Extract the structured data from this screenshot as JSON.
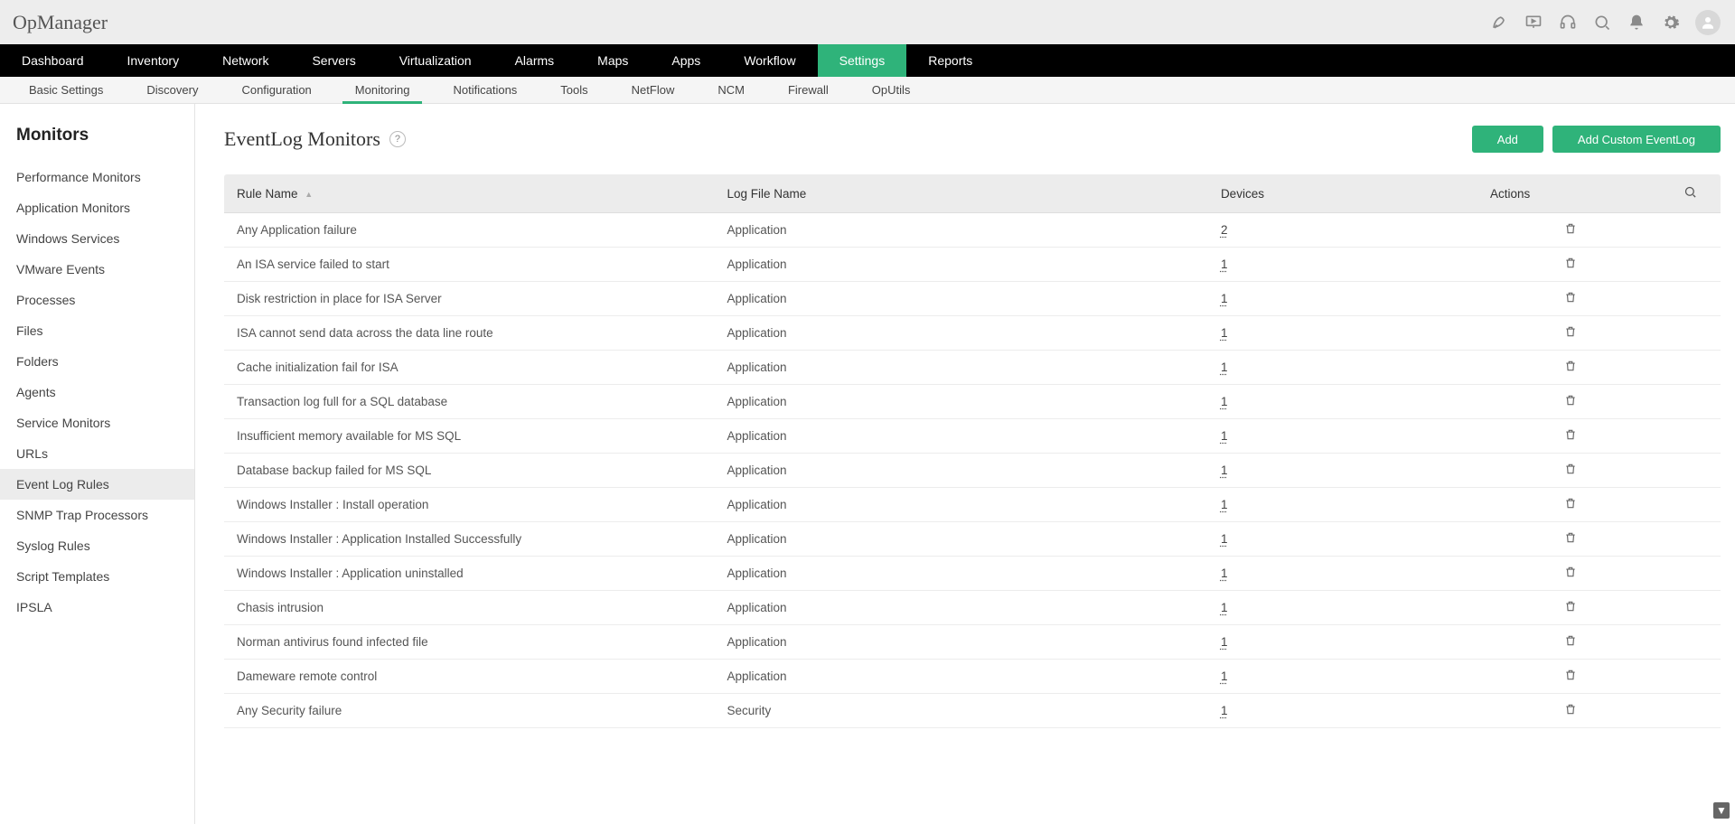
{
  "brand": "OpManager",
  "mainNav": [
    {
      "label": "Dashboard",
      "active": false
    },
    {
      "label": "Inventory",
      "active": false
    },
    {
      "label": "Network",
      "active": false
    },
    {
      "label": "Servers",
      "active": false
    },
    {
      "label": "Virtualization",
      "active": false
    },
    {
      "label": "Alarms",
      "active": false
    },
    {
      "label": "Maps",
      "active": false
    },
    {
      "label": "Apps",
      "active": false
    },
    {
      "label": "Workflow",
      "active": false
    },
    {
      "label": "Settings",
      "active": true
    },
    {
      "label": "Reports",
      "active": false
    }
  ],
  "subNav": [
    {
      "label": "Basic Settings",
      "active": false
    },
    {
      "label": "Discovery",
      "active": false
    },
    {
      "label": "Configuration",
      "active": false
    },
    {
      "label": "Monitoring",
      "active": true
    },
    {
      "label": "Notifications",
      "active": false
    },
    {
      "label": "Tools",
      "active": false
    },
    {
      "label": "NetFlow",
      "active": false
    },
    {
      "label": "NCM",
      "active": false
    },
    {
      "label": "Firewall",
      "active": false
    },
    {
      "label": "OpUtils",
      "active": false
    }
  ],
  "sidebar": {
    "title": "Monitors",
    "items": [
      {
        "label": "Performance Monitors",
        "active": false
      },
      {
        "label": "Application Monitors",
        "active": false
      },
      {
        "label": "Windows Services",
        "active": false
      },
      {
        "label": "VMware Events",
        "active": false
      },
      {
        "label": "Processes",
        "active": false
      },
      {
        "label": "Files",
        "active": false
      },
      {
        "label": "Folders",
        "active": false
      },
      {
        "label": "Agents",
        "active": false
      },
      {
        "label": "Service Monitors",
        "active": false
      },
      {
        "label": "URLs",
        "active": false
      },
      {
        "label": "Event Log Rules",
        "active": true
      },
      {
        "label": "SNMP Trap Processors",
        "active": false
      },
      {
        "label": "Syslog Rules",
        "active": false
      },
      {
        "label": "Script Templates",
        "active": false
      },
      {
        "label": "IPSLA",
        "active": false
      }
    ]
  },
  "page": {
    "title": "EventLog Monitors",
    "help": "?",
    "buttons": {
      "add": "Add",
      "addCustom": "Add Custom EventLog"
    }
  },
  "table": {
    "headers": {
      "ruleName": "Rule Name",
      "logFile": "Log File Name",
      "devices": "Devices",
      "actions": "Actions"
    },
    "rows": [
      {
        "rule": "Any Application failure",
        "log": "Application",
        "devices": "2"
      },
      {
        "rule": "An ISA service failed to start",
        "log": "Application",
        "devices": "1"
      },
      {
        "rule": "Disk restriction in place for ISA Server",
        "log": "Application",
        "devices": "1"
      },
      {
        "rule": "ISA cannot send data across the data line route",
        "log": "Application",
        "devices": "1"
      },
      {
        "rule": "Cache initialization fail for ISA",
        "log": "Application",
        "devices": "1"
      },
      {
        "rule": "Transaction log full for a SQL database",
        "log": "Application",
        "devices": "1"
      },
      {
        "rule": "Insufficient memory available for MS SQL",
        "log": "Application",
        "devices": "1"
      },
      {
        "rule": "Database backup failed for MS SQL",
        "log": "Application",
        "devices": "1"
      },
      {
        "rule": "Windows Installer : Install operation",
        "log": "Application",
        "devices": "1"
      },
      {
        "rule": "Windows Installer : Application Installed Successfully",
        "log": "Application",
        "devices": "1"
      },
      {
        "rule": "Windows Installer : Application uninstalled",
        "log": "Application",
        "devices": "1"
      },
      {
        "rule": "Chasis intrusion",
        "log": "Application",
        "devices": "1"
      },
      {
        "rule": "Norman antivirus found infected file",
        "log": "Application",
        "devices": "1"
      },
      {
        "rule": "Dameware remote control",
        "log": "Application",
        "devices": "1"
      },
      {
        "rule": "Any Security failure",
        "log": "Security",
        "devices": "1"
      }
    ]
  }
}
